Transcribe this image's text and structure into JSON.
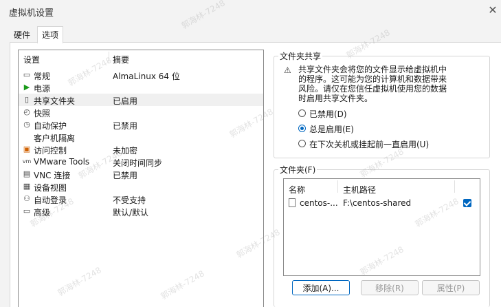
{
  "window": {
    "title": "虚拟机设置",
    "close_glyph": "✕"
  },
  "tabs": [
    {
      "label": "硬件"
    },
    {
      "label": "选项"
    }
  ],
  "settings_list": {
    "headers": {
      "setting": "设置",
      "summary": "摘要"
    },
    "items": [
      {
        "name": "常规",
        "summary": "AlmaLinux 64 位",
        "icon": "general-icon",
        "glyph": "▭"
      },
      {
        "name": "电源",
        "summary": "",
        "icon": "power-icon",
        "glyph": "▶"
      },
      {
        "name": "共享文件夹",
        "summary": "已启用",
        "icon": "shared-folders-icon",
        "glyph": "▯"
      },
      {
        "name": "快照",
        "summary": "",
        "icon": "snapshot-icon",
        "glyph": "◴"
      },
      {
        "name": "自动保护",
        "summary": "已禁用",
        "icon": "autoprotect-icon",
        "glyph": "◷"
      },
      {
        "name": "客户机隔离",
        "summary": "",
        "icon": "isolation-icon",
        "glyph": ""
      },
      {
        "name": "访问控制",
        "summary": "未加密",
        "icon": "access-control-icon",
        "glyph": "▣"
      },
      {
        "name": "VMware Tools",
        "summary": "关闭时间同步",
        "icon": "vmware-tools-icon",
        "glyph": "vm"
      },
      {
        "name": "VNC 连接",
        "summary": "已禁用",
        "icon": "vnc-icon",
        "glyph": "▤"
      },
      {
        "name": "设备视图",
        "summary": "",
        "icon": "device-view-icon",
        "glyph": "▦"
      },
      {
        "name": "自动登录",
        "summary": "不受支持",
        "icon": "autologin-icon",
        "glyph": "⚇"
      },
      {
        "name": "高级",
        "summary": "默认/默认",
        "icon": "advanced-icon",
        "glyph": "▭"
      }
    ]
  },
  "folder_sharing": {
    "legend": "文件夹共享",
    "warning": "共享文件夹会将您的文件显示给虚拟机中的程序。这可能为您的计算机和数据带来风险。请仅在您信任虚拟机使用您的数据时启用共享文件夹。",
    "options": [
      {
        "label": "已禁用(D)",
        "selected": false
      },
      {
        "label": "总是启用(E)",
        "selected": true
      },
      {
        "label": "在下次关机或挂起前一直启用(U)",
        "selected": false
      }
    ]
  },
  "folders": {
    "legend": "文件夹(F)",
    "headers": {
      "name": "名称",
      "host_path": "主机路径"
    },
    "rows": [
      {
        "name": "centos-...",
        "host_path": "F:\\centos-shared",
        "enabled": true
      }
    ],
    "buttons": {
      "add": "添加(A)...",
      "remove": "移除(R)",
      "properties": "属性(P)"
    }
  },
  "watermark": "郭海林-7248"
}
